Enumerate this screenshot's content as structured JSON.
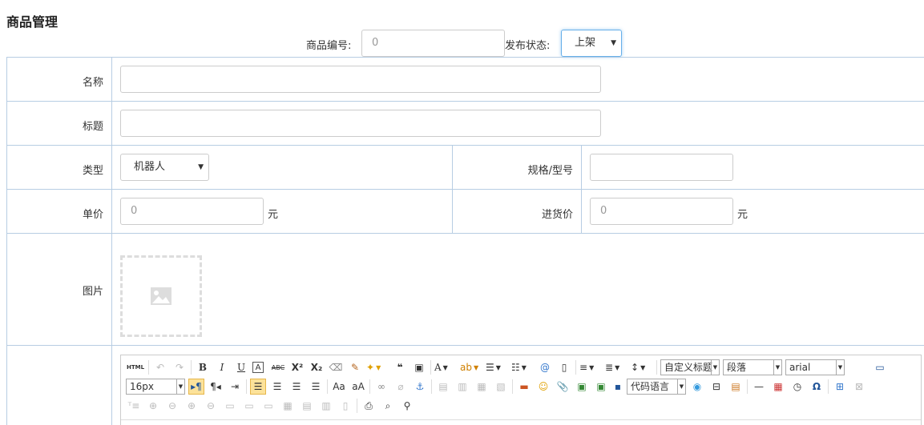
{
  "page": {
    "title": "商品管理"
  },
  "topbar": {
    "product_no_label": "商品编号:",
    "product_no_placeholder": "0",
    "status_label": "发布状态:",
    "status_value": "上架"
  },
  "form": {
    "name_label": "名称",
    "name_value": "",
    "title_label": "标题",
    "title_value": "",
    "type_label": "类型",
    "type_value": "机器人",
    "spec_label": "规格/型号",
    "spec_value": "",
    "price_label": "单价",
    "price_placeholder": "0",
    "price_unit": "元",
    "cost_label": "进货价",
    "cost_placeholder": "0",
    "cost_unit": "元",
    "image_label": "图片"
  },
  "editor": {
    "html_label": "HTML",
    "font_size": "16px",
    "custom_title": "自定义标题",
    "paragraph": "段落",
    "font_family": "arial",
    "code_language": "代码语言"
  },
  "colors": {
    "border": "#b7cde3",
    "focus": "#66afe9",
    "active_tool": "#fce29a"
  }
}
